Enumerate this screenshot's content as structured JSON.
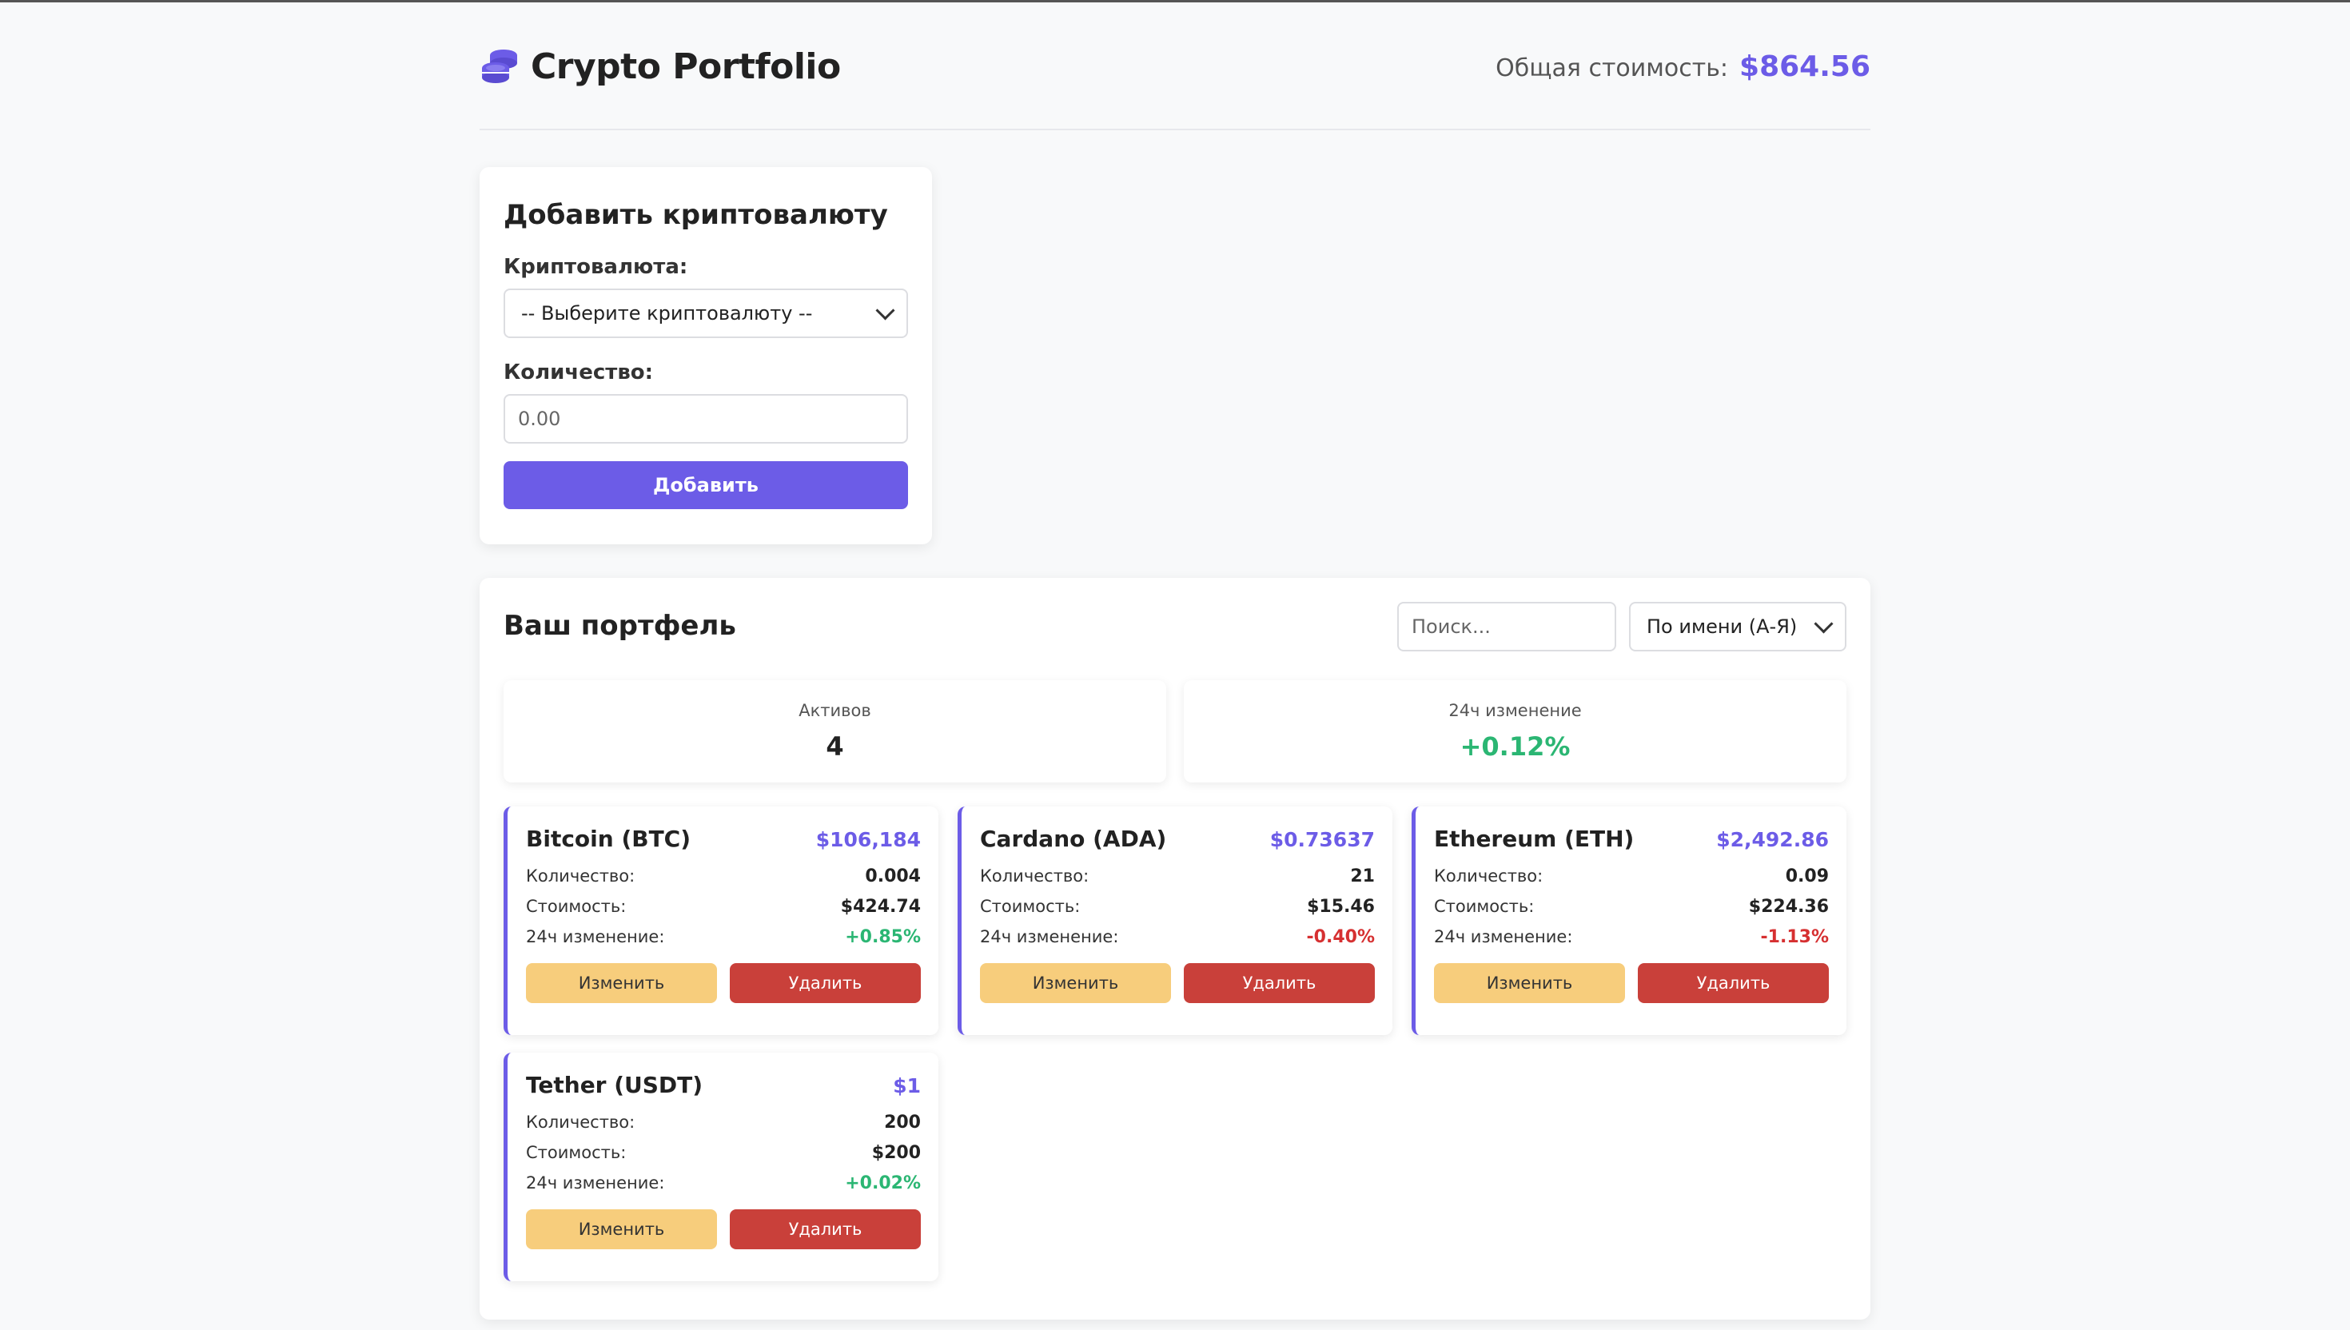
{
  "header": {
    "title": "Crypto Portfolio",
    "total_label": "Общая стоимость:",
    "total_value": "$864.56"
  },
  "add_form": {
    "title": "Добавить криптовалюту",
    "currency_label": "Криптовалюта:",
    "currency_select_value": "-- Выберите криптовалюту --",
    "quantity_label": "Количество:",
    "quantity_placeholder": "0.00",
    "submit_label": "Добавить"
  },
  "portfolio": {
    "title": "Ваш портфель",
    "search_placeholder": "Поиск...",
    "sort_value": "По имени (А-Я)",
    "stats": {
      "assets_label": "Активов",
      "assets_value": "4",
      "change_label": "24ч изменение",
      "change_value": "+0.12%"
    },
    "labels": {
      "quantity": "Количество:",
      "value": "Стоимость:",
      "change": "24ч изменение:",
      "edit": "Изменить",
      "delete": "Удалить"
    },
    "coins": [
      {
        "name": "Bitcoin (BTC)",
        "price": "$106,184",
        "quantity": "0.004",
        "value": "$424.74",
        "change": "+0.85%",
        "change_direction": "up"
      },
      {
        "name": "Cardano (ADA)",
        "price": "$0.73637",
        "quantity": "21",
        "value": "$15.46",
        "change": "-0.40%",
        "change_direction": "down"
      },
      {
        "name": "Ethereum (ETH)",
        "price": "$2,492.86",
        "quantity": "0.09",
        "value": "$224.36",
        "change": "-1.13%",
        "change_direction": "down"
      },
      {
        "name": "Tether (USDT)",
        "price": "$1",
        "quantity": "200",
        "value": "$200",
        "change": "+0.02%",
        "change_direction": "up"
      }
    ]
  },
  "colors": {
    "accent": "#6c5ce7",
    "positive": "#2bb673",
    "negative": "#d63031",
    "edit_button": "#f7cd7c",
    "delete_button": "#c9403a",
    "background": "#f8f9fa"
  },
  "icons": {
    "brand": "coins-icon",
    "select_arrow": "chevron-down-icon"
  }
}
